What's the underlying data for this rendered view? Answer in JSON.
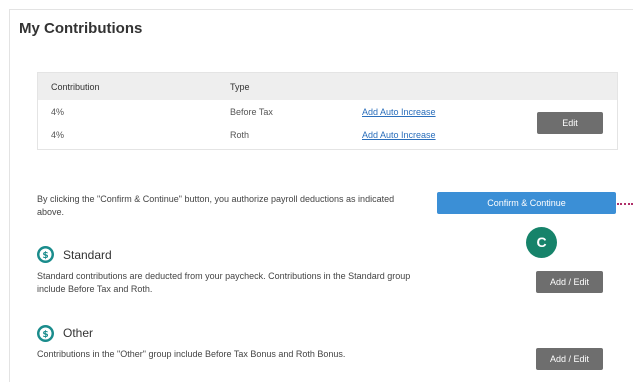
{
  "page": {
    "title": "My Contributions"
  },
  "table": {
    "headers": [
      "Contribution",
      "Type"
    ],
    "rows": [
      {
        "contribution": "4%",
        "type": "Before Tax",
        "action": "Add Auto Increase"
      },
      {
        "contribution": "4%",
        "type": "Roth",
        "action": "Add Auto Increase"
      }
    ],
    "edit_label": "Edit"
  },
  "confirm": {
    "note": "By clicking the \"Confirm & Continue\" button, you authorize payroll deductions as indicated above.",
    "button_label": "Confirm & Continue"
  },
  "callout": {
    "label": "C",
    "color": "#16836a"
  },
  "sections": [
    {
      "icon": "dollar-circle-icon",
      "title": "Standard",
      "description": "Standard contributions are deducted from your paycheck. Contributions in the Standard group include Before Tax and Roth.",
      "button_label": "Add / Edit"
    },
    {
      "icon": "dollar-circle-icon",
      "title": "Other",
      "description": "Contributions in the \"Other\" group include Before Tax Bonus and Roth Bonus.",
      "button_label": "Add / Edit"
    }
  ],
  "colors": {
    "link": "#2a6ebb",
    "primary_button": "#3b8fd6",
    "secondary_button": "#6e6e6e",
    "icon_teal": "#1a8c8c"
  }
}
